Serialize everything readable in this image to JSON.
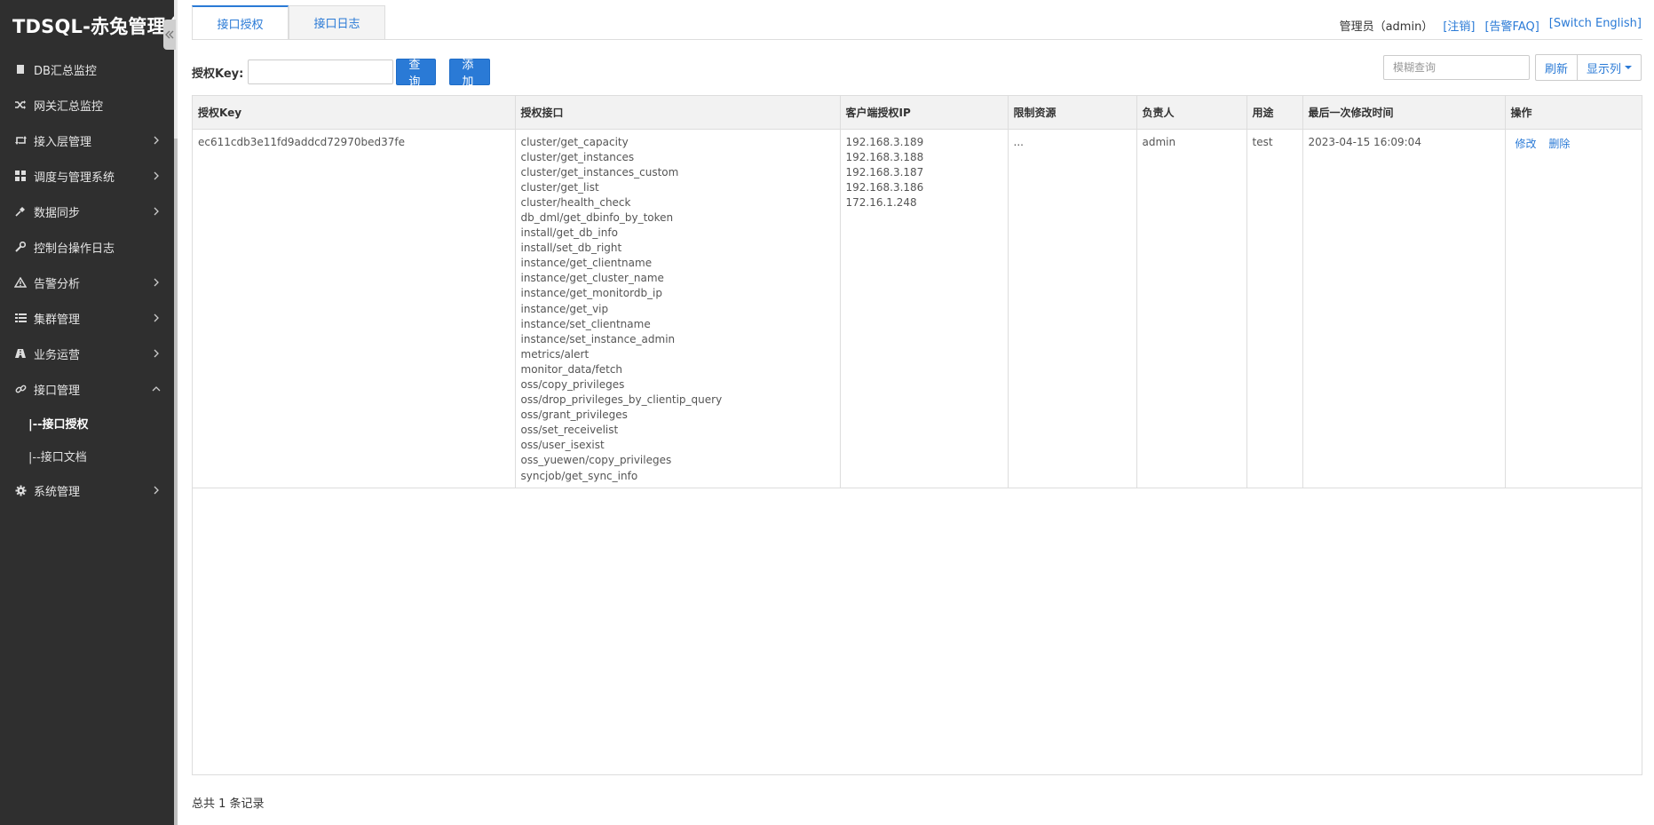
{
  "app": {
    "brand": "TDSQL-赤兔管理台"
  },
  "sidebar": {
    "items": [
      {
        "label": "DB汇总监控",
        "icon": "database-icon",
        "has_children": false
      },
      {
        "label": "网关汇总监控",
        "icon": "shuffle-icon",
        "has_children": false
      },
      {
        "label": "接入层管理",
        "icon": "retweet-icon",
        "has_children": true
      },
      {
        "label": "调度与管理系统",
        "icon": "grid-icon",
        "has_children": true
      },
      {
        "label": "数据同步",
        "icon": "plug-icon",
        "has_children": true
      },
      {
        "label": "控制台操作日志",
        "icon": "wrench-icon",
        "has_children": false
      },
      {
        "label": "告警分析",
        "icon": "warning-icon",
        "has_children": true
      },
      {
        "label": "集群管理",
        "icon": "list-icon",
        "has_children": true
      },
      {
        "label": "业务运营",
        "icon": "road-icon",
        "has_children": true
      },
      {
        "label": "接口管理",
        "icon": "link-icon",
        "has_children": true,
        "expanded": true
      },
      {
        "label": "系统管理",
        "icon": "gear-icon",
        "has_children": true
      }
    ],
    "sub_items": [
      {
        "label": "|--接口授权",
        "active": true
      },
      {
        "label": "|--接口文档",
        "active": false
      }
    ]
  },
  "tabs": [
    {
      "label": "接口授权",
      "active": true
    },
    {
      "label": "接口日志",
      "active": false
    }
  ],
  "header": {
    "user": "管理员（admin）",
    "logout": "[注销]",
    "faq": "[告警FAQ]",
    "switch_lang": "[Switch English]"
  },
  "search": {
    "label": "授权Key:",
    "key_value": "",
    "query_button": "查询",
    "add_button": "添加",
    "fuzzy_placeholder": "模糊查询",
    "refresh_button": "刷新",
    "columns_button": "显示列"
  },
  "table": {
    "columns": [
      "授权Key",
      "授权接口",
      "客户端授权IP",
      "限制资源",
      "负责人",
      "用途",
      "最后一次修改时间",
      "操作"
    ],
    "rows": [
      {
        "key": "ec611cdb3e11fd9addcd72970bed37fe",
        "interfaces": [
          "cluster/get_capacity",
          "cluster/get_instances",
          "cluster/get_instances_custom",
          "cluster/get_list",
          "cluster/health_check",
          "db_dml/get_dbinfo_by_token",
          "install/get_db_info",
          "install/set_db_right",
          "instance/get_clientname",
          "instance/get_cluster_name",
          "instance/get_monitordb_ip",
          "instance/get_vip",
          "instance/set_clientname",
          "instance/set_instance_admin",
          "metrics/alert",
          "monitor_data/fetch",
          "oss/copy_privileges",
          "oss/drop_privileges_by_clientip_query",
          "oss/grant_privileges",
          "oss/set_receivelist",
          "oss/user_isexist",
          "oss_yuewen/copy_privileges",
          "syncjob/get_sync_info"
        ],
        "ips": [
          "192.168.3.189",
          "192.168.3.188",
          "192.168.3.187",
          "192.168.3.186",
          "172.16.1.248"
        ],
        "resources": "...",
        "owner": "admin",
        "purpose": "test",
        "modified": "2023-04-15 16:09:04",
        "actions": {
          "edit": "修改",
          "delete": "删除"
        }
      }
    ]
  },
  "footer": {
    "total": "总共 1 条记录"
  }
}
